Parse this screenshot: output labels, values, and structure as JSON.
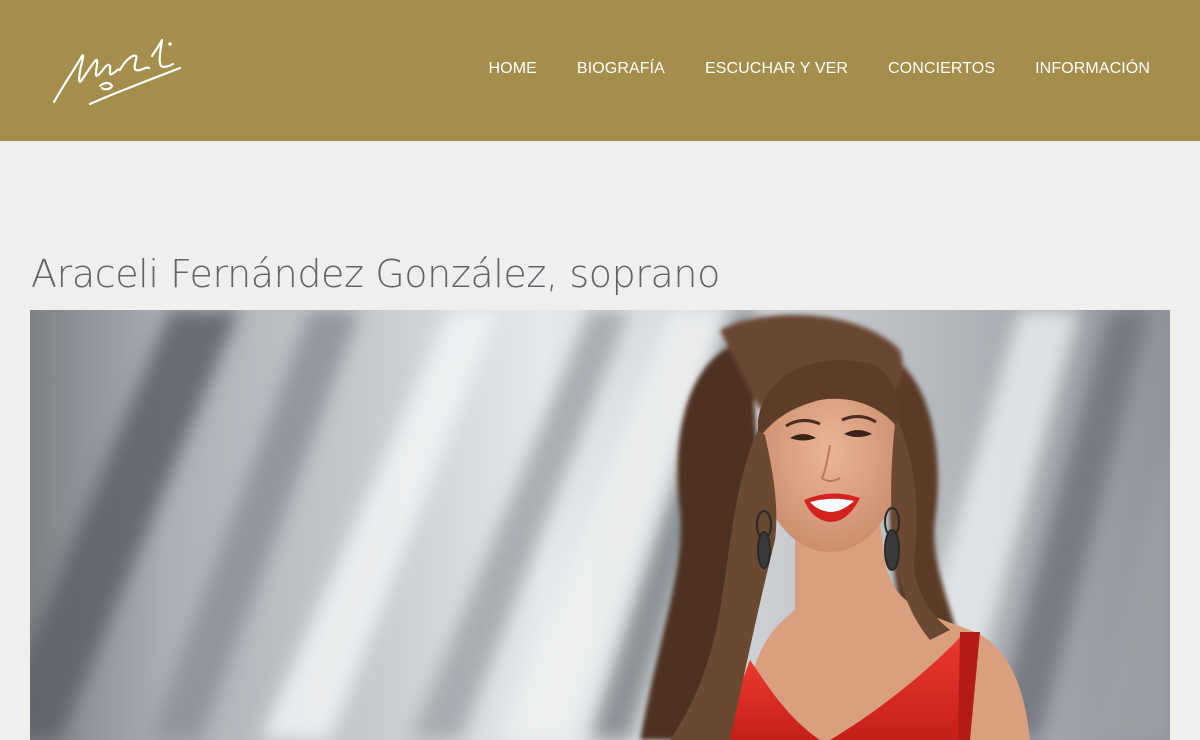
{
  "header": {
    "background_color": "#a58d4b",
    "logo": {
      "icon": "signature-logo-icon",
      "color": "#ffffff"
    },
    "nav": [
      {
        "label": "HOME"
      },
      {
        "label": "BIOGRAFÍA"
      },
      {
        "label": "ESCUCHAR Y VER"
      },
      {
        "label": "CONCIERTOS"
      },
      {
        "label": "INFORMACIÓN"
      }
    ]
  },
  "main": {
    "title": "Araceli Fernández González, soprano",
    "hero_image": {
      "subject": "portrait-photo",
      "dress_color": "#e22a24",
      "hair_color": "#5a3b27",
      "background_tones": [
        "#6f7479",
        "#d9dde0",
        "#9aa1a7"
      ]
    }
  }
}
